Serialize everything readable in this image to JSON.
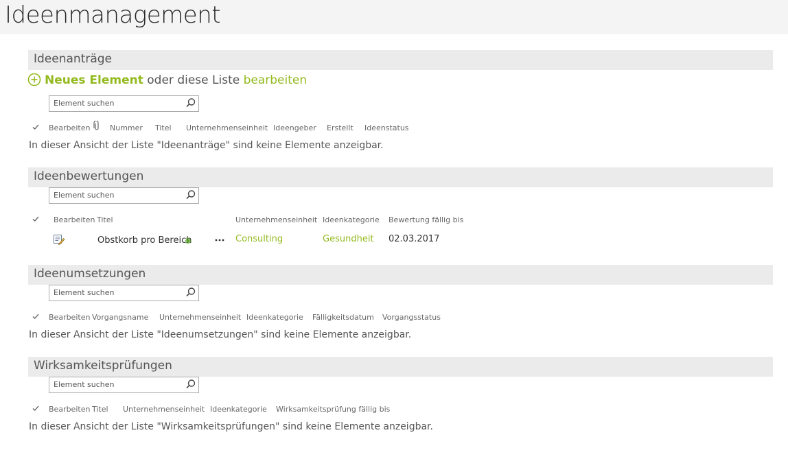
{
  "page": {
    "title": "Ideenmanagement"
  },
  "search_placeholder": "Element suchen",
  "new_item": {
    "link_label": "Neues Element",
    "middle_text": "oder diese Liste",
    "edit_label": "bearbeiten"
  },
  "lists": [
    {
      "title": "Ideenanträge",
      "columns": [
        "Bearbeiten",
        "Nummer",
        "Titel",
        "Unternehmenseinheit",
        "Ideengeber",
        "Erstellt",
        "Ideenstatus"
      ],
      "empty_message": "In dieser Ansicht der Liste \"Ideenanträge\" sind keine Elemente anzeigbar."
    },
    {
      "title": "Ideenbewertungen",
      "columns": [
        "Bearbeiten",
        "Titel",
        "Unternehmenseinheit",
        "Ideenkategorie",
        "Bewertung fällig bis"
      ],
      "rows": [
        {
          "titel": "Obstkorb pro Bereich",
          "unternehmenseinheit": "Consulting",
          "ideenkategorie": "Gesundheit",
          "bewertung_faellig_bis": "02.03.2017"
        }
      ]
    },
    {
      "title": "Ideenumsetzungen",
      "columns": [
        "Bearbeiten",
        "Vorgangsname",
        "Unternehmenseinheit",
        "Ideenkategorie",
        "Fälligkeitsdatum",
        "Vorgangsstatus"
      ],
      "empty_message": "In dieser Ansicht der Liste \"Ideenumsetzungen\" sind keine Elemente anzeigbar."
    },
    {
      "title": "Wirksamkeitsprüfungen",
      "columns": [
        "Bearbeiten",
        "Titel",
        "Unternehmenseinheit",
        "Ideenkategorie",
        "Wirksamkeitsprüfung fällig bis"
      ],
      "empty_message": "In dieser Ansicht der Liste \"Wirksamkeitsprüfungen\" sind keine Elemente anzeigbar."
    }
  ],
  "colors": {
    "accent_green": "#94ba1f",
    "section_bar": "#ebebeb",
    "header_bg": "#f4f4f4"
  },
  "icons": [
    "plus-circle-icon",
    "search-icon",
    "checkmark-icon",
    "paperclip-icon",
    "edit-document-icon",
    "new-item-sparkle-icon",
    "ellipsis-icon"
  ]
}
